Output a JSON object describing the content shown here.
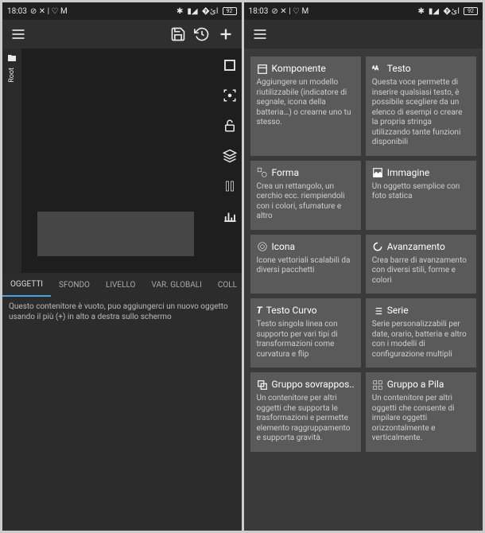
{
  "status": {
    "time": "18:03",
    "battery": "92"
  },
  "left": {
    "rail_label": "Root",
    "tabs": {
      "t0": "OGGETTI",
      "t1": "SFONDO",
      "t2": "LIVELLO",
      "t3": "VAR. GLOBALI",
      "t4": "COLL"
    },
    "hint": "Questo contenitore è vuoto, puo aggiungerci un nuovo oggetto usando il più (+) in alto a destra sullo schermo"
  },
  "cards": {
    "c0": {
      "title": "Komponente",
      "desc": "Aggiungere un modello riutilizzabile (indicatore di segnale, icona della batteria…) o crearne uno tu stesso."
    },
    "c1": {
      "title": "Testo",
      "desc": "Questa voce permette di inserire qualsiasi testo, è possibile scegliere da un elenco di esempi o creare la propria stringa utilizzando tante funzioni disponibili"
    },
    "c2": {
      "title": "Forma",
      "desc": "Crea un rettangolo, un cerchio ecc. riempiendoli con i colori, sfumature e altro"
    },
    "c3": {
      "title": "Immagine",
      "desc": "Un oggetto semplice con foto statica"
    },
    "c4": {
      "title": "Icona",
      "desc": "Icone vettoriali scalabili da diversi pacchetti"
    },
    "c5": {
      "title": "Avanzamento",
      "desc": "Crea barre di avanzamento con diversi stili, forme e colori"
    },
    "c6": {
      "title": "Testo Curvo",
      "desc": "Testo singola linea con supporto per vari tipi di transformazioni come curvatura e flip"
    },
    "c7": {
      "title": "Serie",
      "desc": "Serie personalizzabili per date, orario, batteria e altro con i modelli di configurazione multipli"
    },
    "c8": {
      "title": "Gruppo sovrappos..",
      "desc": "Un contenitore per altri oggetti che supporta le trasformazioni e permette elemento raggruppamento e supporta gravità."
    },
    "c9": {
      "title": "Gruppo a Pila",
      "desc": "Un contenitore per altri oggetti che consente di impilare oggetti orizzontalmente e verticalmente."
    }
  }
}
